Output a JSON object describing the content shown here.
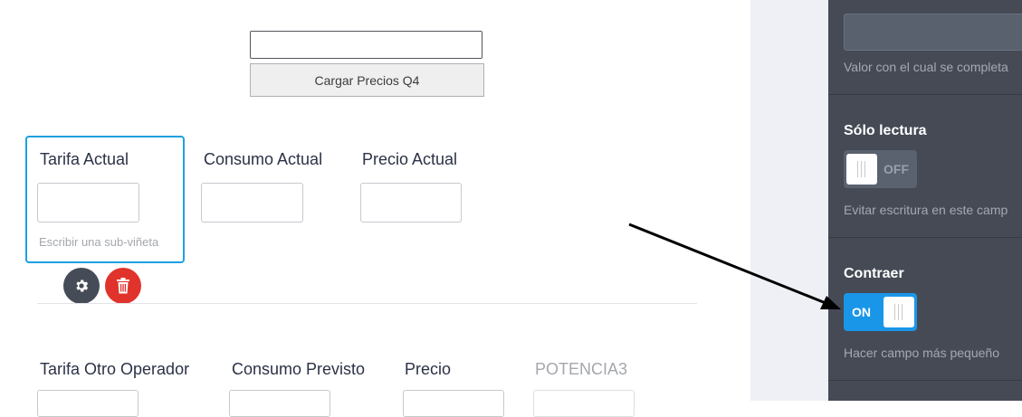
{
  "top": {
    "load_button_label": "Cargar Precios Q4"
  },
  "fields_row1": {
    "tarifa_actual": "Tarifa Actual",
    "consumo_actual": "Consumo Actual",
    "precio_actual": "Precio Actual",
    "sublabel_placeholder": "Escribir una sub-viñeta"
  },
  "fields_row2": {
    "tarifa_otro": "Tarifa Otro Operador",
    "consumo_previsto": "Consumo Previsto",
    "precio": "Precio",
    "potencia3": "POTENCIA3"
  },
  "colors": {
    "accent": "#1fa0e0",
    "delete": "#e0332c",
    "panel_bg": "#454a55",
    "toggle_on": "#1a96e8"
  },
  "panel": {
    "default_value": {
      "description": "Valor con el cual se completa"
    },
    "read_only": {
      "title": "Sólo lectura",
      "toggle_text": "OFF",
      "toggle_state": "off",
      "description": "Evitar escritura en este camp"
    },
    "shrink": {
      "title": "Contraer",
      "toggle_text": "ON",
      "toggle_state": "on",
      "description": "Hacer campo más pequeño"
    }
  }
}
